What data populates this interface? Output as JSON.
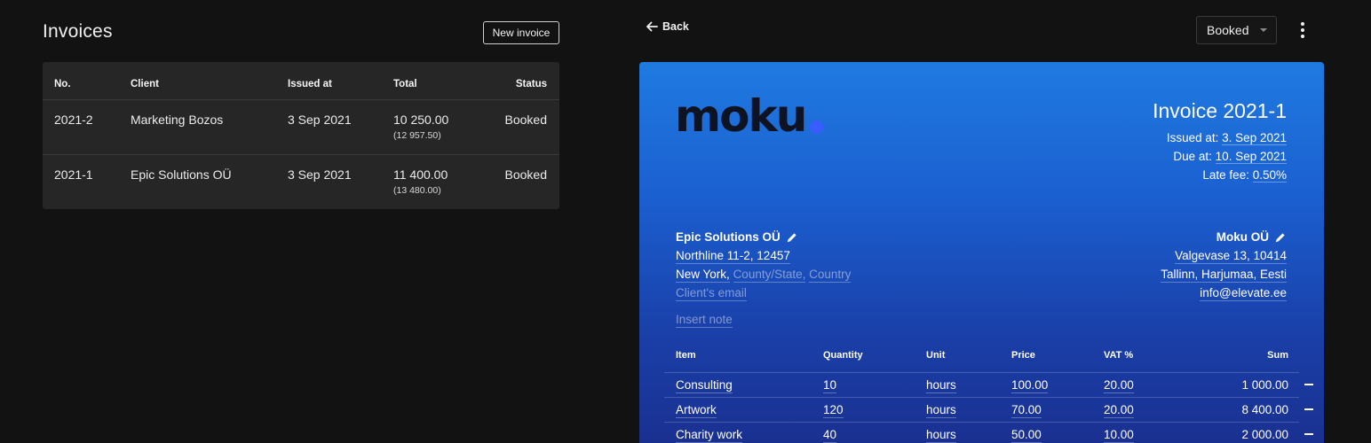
{
  "list": {
    "title": "Invoices",
    "new_button": "New invoice",
    "columns": [
      "No.",
      "Client",
      "Issued at",
      "Total",
      "Status"
    ],
    "rows": [
      {
        "no": "2021-2",
        "client": "Marketing Bozos",
        "issued": "3 Sep 2021",
        "total": "10 250.00",
        "total_gross": "(12 957.50)",
        "status": "Booked"
      },
      {
        "no": "2021-1",
        "client": "Epic Solutions OÜ",
        "issued": "3 Sep 2021",
        "total": "11 400.00",
        "total_gross": "(13 480.00)",
        "status": "Booked"
      }
    ]
  },
  "detail": {
    "back_label": "Back",
    "status_value": "Booked",
    "logo_text": "moku",
    "title": "Invoice 2021-1",
    "issued_label": "Issued at:",
    "issued_value": "3. Sep 2021",
    "due_label": "Due at:",
    "due_value": "10. Sep 2021",
    "late_fee_label": "Late fee:",
    "late_fee_value": "0.50%",
    "client": {
      "name": "Epic Solutions OÜ",
      "street": "Northline 11-2, 12457",
      "city": "New York,",
      "county_placeholder": "County/State,",
      "country_placeholder": "Country",
      "email_placeholder": "Client's email"
    },
    "seller": {
      "name": "Moku OÜ",
      "street": "Valgevase 13, 10414",
      "city": "Tallinn, Harjumaa, Eesti",
      "email": "info@elevate.ee"
    },
    "note_placeholder": "Insert note",
    "item_columns": [
      "Item",
      "Quantity",
      "Unit",
      "Price",
      "VAT %",
      "Sum"
    ],
    "items": [
      {
        "item": "Consulting",
        "qty": "10",
        "unit": "hours",
        "price": "100.00",
        "vat": "20.00",
        "sum": "1 000.00"
      },
      {
        "item": "Artwork",
        "qty": "120",
        "unit": "hours",
        "price": "70.00",
        "vat": "20.00",
        "sum": "8 400.00"
      },
      {
        "item": "Charity work",
        "qty": "40",
        "unit": "hours",
        "price": "50.00",
        "vat": "10.00",
        "sum": "2 000.00"
      }
    ],
    "colors": {
      "accent": "#1f7ae0",
      "logo_dot": "#3a5cff",
      "background": "#121212",
      "table": "#262626"
    }
  }
}
